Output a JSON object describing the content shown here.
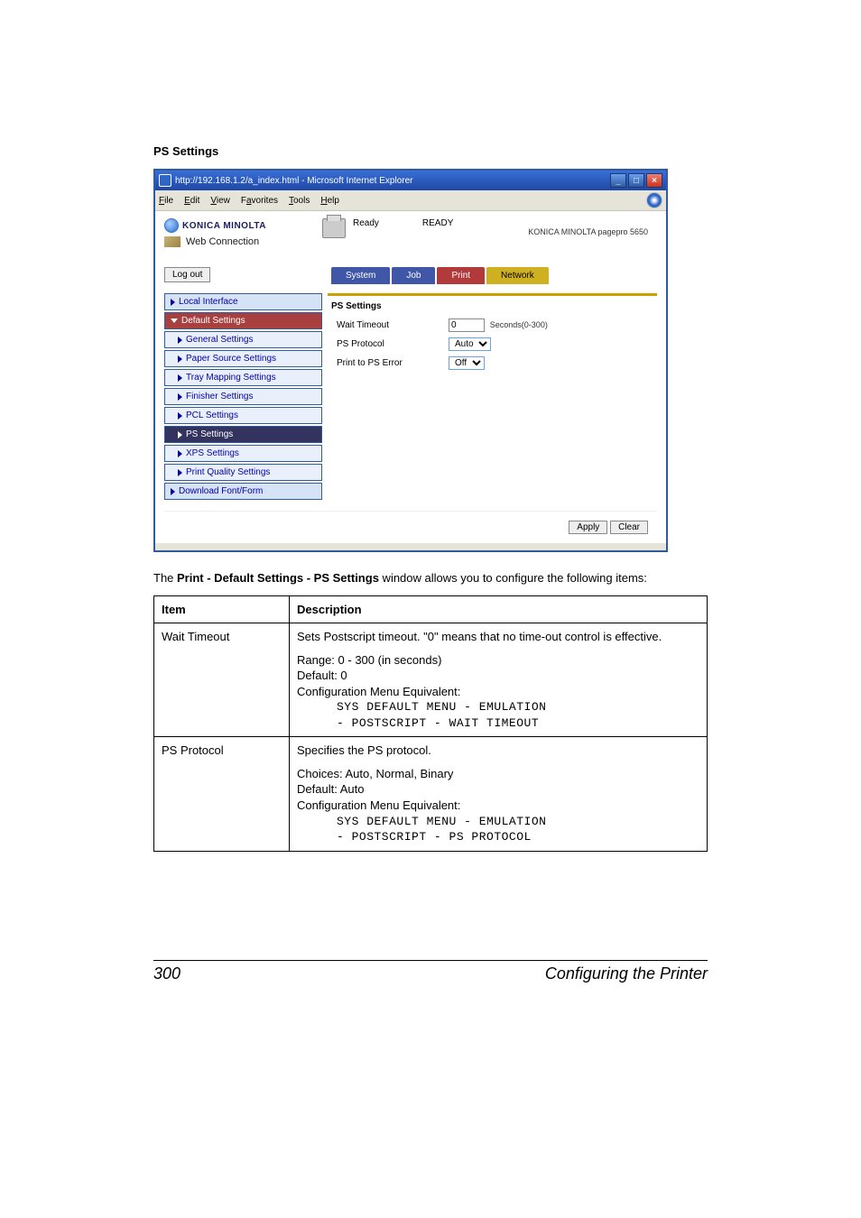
{
  "section_title": "PS Settings",
  "browser": {
    "title": "http://192.168.1.2/a_index.html - Microsoft Internet Explorer",
    "menus": [
      "File",
      "Edit",
      "View",
      "Favorites",
      "Tools",
      "Help"
    ]
  },
  "header": {
    "brand": "KONICA MINOLTA",
    "web_connection": "Web Connection",
    "status_short": "Ready",
    "status_big": "READY",
    "model": "KONICA MINOLTA pagepro 5650"
  },
  "logout": "Log out",
  "tabs": {
    "system": "System",
    "job": "Job",
    "print": "Print",
    "network": "Network"
  },
  "sidebar": {
    "local_interface": "Local Interface",
    "default_settings": "Default Settings",
    "general": "General Settings",
    "paper_source": "Paper Source Settings",
    "tray_mapping": "Tray Mapping Settings",
    "finisher": "Finisher Settings",
    "pcl": "PCL Settings",
    "ps": "PS Settings",
    "xps": "XPS Settings",
    "print_quality": "Print Quality Settings",
    "download": "Download Font/Form"
  },
  "panel": {
    "title": "PS Settings",
    "wait_timeout": {
      "label": "Wait Timeout",
      "value": "0",
      "suffix": "Seconds(0-300)"
    },
    "ps_protocol": {
      "label": "PS Protocol",
      "value": "Auto"
    },
    "print_ps_error": {
      "label": "Print to PS Error",
      "value": "Off"
    }
  },
  "buttons": {
    "apply": "Apply",
    "clear": "Clear"
  },
  "body_text": {
    "pre": "The ",
    "bold": "Print - Default Settings - PS Settings",
    "post": " window allows you to configure the following items:"
  },
  "table": {
    "h_item": "Item",
    "h_desc": "Description",
    "rows": [
      {
        "item": "Wait Timeout",
        "p1": "Sets Postscript timeout. \"0\" means that no time-out control is effective.",
        "range": "Range:  0 - 300 (in seconds)",
        "default": "Default:  0",
        "cfg": "Configuration Menu Equivalent:",
        "m1": "SYS DEFAULT MENU - EMULATION",
        "m2": "- POSTSCRIPT - WAIT TIMEOUT"
      },
      {
        "item": "PS Protocol",
        "p1": "Specifies the PS protocol.",
        "choices": "Choices: Auto, Normal, Binary",
        "default": "Default:  Auto",
        "cfg": "Configuration Menu Equivalent:",
        "m1": "SYS DEFAULT MENU - EMULATION",
        "m2": "- POSTSCRIPT - PS PROTOCOL"
      }
    ]
  },
  "footer": {
    "page": "300",
    "title": "Configuring the Printer"
  }
}
